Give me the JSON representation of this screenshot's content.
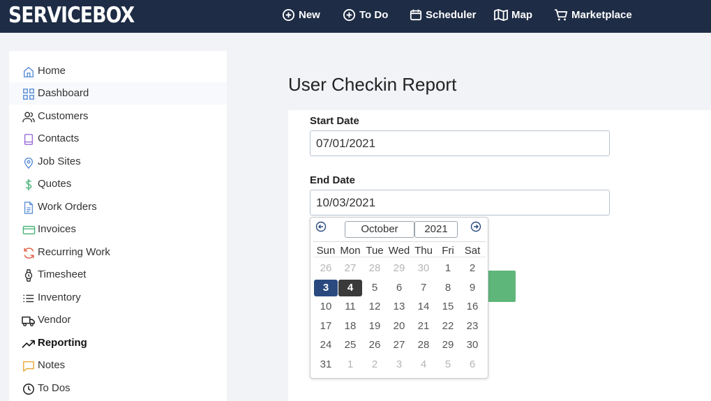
{
  "app": {
    "logo": "SERVICEBOX"
  },
  "topnav": [
    {
      "label": "New",
      "icon": "plus-circle-icon"
    },
    {
      "label": "To Do",
      "icon": "plus-circle-icon"
    },
    {
      "label": "Scheduler",
      "icon": "calendar-icon"
    },
    {
      "label": "Map",
      "icon": "map-icon"
    },
    {
      "label": "Marketplace",
      "icon": "cart-icon"
    }
  ],
  "sidebar": {
    "items": [
      {
        "label": "Home",
        "icon": "home-icon"
      },
      {
        "label": "Dashboard",
        "icon": "dashboard-icon"
      },
      {
        "label": "Customers",
        "icon": "users-icon"
      },
      {
        "label": "Contacts",
        "icon": "book-icon"
      },
      {
        "label": "Job Sites",
        "icon": "map-pin-icon"
      },
      {
        "label": "Quotes",
        "icon": "dollar-icon"
      },
      {
        "label": "Work Orders",
        "icon": "document-icon"
      },
      {
        "label": "Invoices",
        "icon": "credit-card-icon"
      },
      {
        "label": "Recurring Work",
        "icon": "refresh-icon"
      },
      {
        "label": "Timesheet",
        "icon": "watch-icon"
      },
      {
        "label": "Inventory",
        "icon": "list-icon"
      },
      {
        "label": "Vendor",
        "icon": "truck-icon"
      },
      {
        "label": "Reporting",
        "icon": "trending-up-icon"
      },
      {
        "label": "Notes",
        "icon": "message-icon"
      },
      {
        "label": "To Dos",
        "icon": "clock-icon"
      }
    ]
  },
  "main": {
    "title": "User Checkin Report",
    "start_label": "Start Date",
    "start_value": "07/01/2021",
    "end_label": "End Date",
    "end_value": "10/03/2021"
  },
  "calendar": {
    "month": "October",
    "year": "2021",
    "weekdays": [
      "Sun",
      "Mon",
      "Tue",
      "Wed",
      "Thu",
      "Fri",
      "Sat"
    ],
    "weeks": [
      [
        "26",
        "27",
        "28",
        "29",
        "30",
        "1",
        "2"
      ],
      [
        "3",
        "4",
        "5",
        "6",
        "7",
        "8",
        "9"
      ],
      [
        "10",
        "11",
        "12",
        "13",
        "14",
        "15",
        "16"
      ],
      [
        "17",
        "18",
        "19",
        "20",
        "21",
        "22",
        "23"
      ],
      [
        "24",
        "25",
        "26",
        "27",
        "28",
        "29",
        "30"
      ],
      [
        "31",
        "1",
        "2",
        "3",
        "4",
        "5",
        "6"
      ]
    ],
    "selected_day": "3",
    "today_day": "4"
  },
  "colors": {
    "topbar": "#1e2c45",
    "selected_day": "#2a4a7f",
    "today_day": "#3a3a3a",
    "submit_button": "#5fb67b"
  }
}
